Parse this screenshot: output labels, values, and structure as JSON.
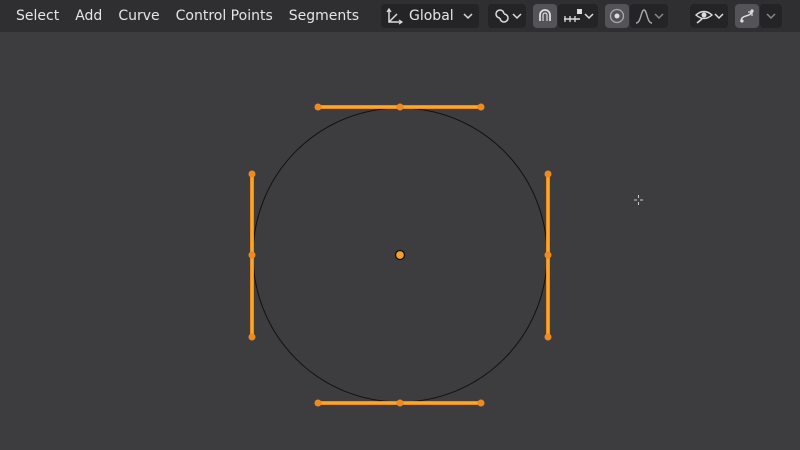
{
  "menu": {
    "select": "Select",
    "add": "Add",
    "curve": "Curve",
    "control_points": "Control Points",
    "segments": "Segments"
  },
  "transform": {
    "orientation": "Global"
  },
  "colors": {
    "header_bg": "#2f2e31",
    "viewport_bg": "#3d3c3f",
    "handle": "#f08a1c",
    "handle_line": "#ffb128",
    "curve": "#111111"
  },
  "icons": [
    "transform-orientation-icon",
    "pivot-point-icon",
    "snap-icon",
    "snap-increment-icon",
    "proportional-editing-icon",
    "proportional-falloff-icon",
    "visibility-icon",
    "overlay-icon"
  ]
}
